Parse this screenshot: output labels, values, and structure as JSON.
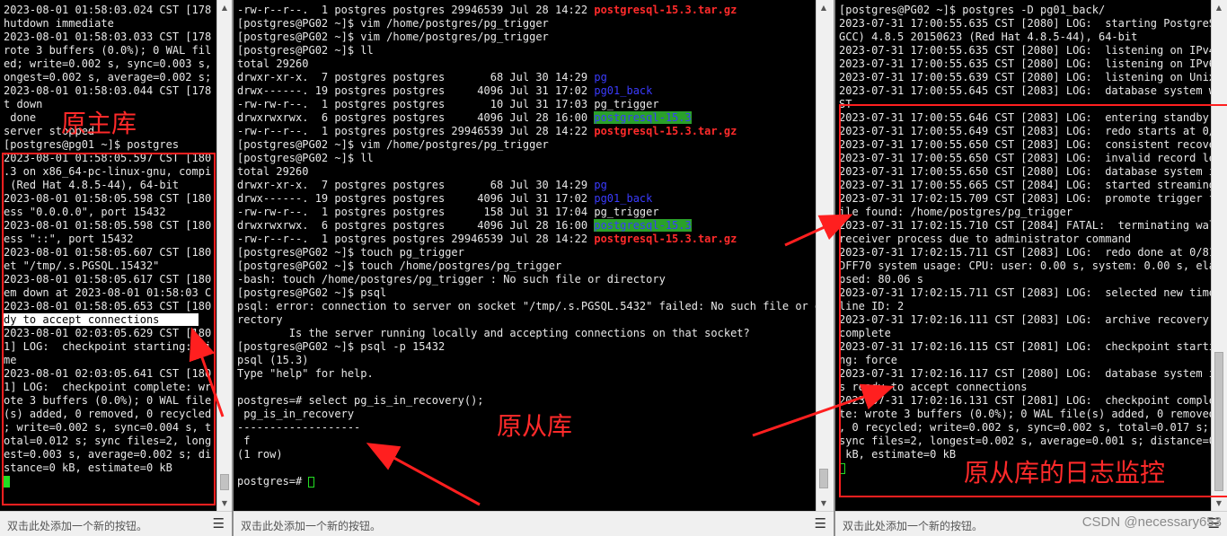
{
  "left": {
    "lines": [
      [
        {
          "t": "2023-08-01 01:58:03.024 CST [178"
        }
      ],
      [
        {
          "t": "hutdown immediate"
        }
      ],
      [
        {
          "t": "2023-08-01 01:58:03.033 CST [178"
        }
      ],
      [
        {
          "t": "rote 3 buffers (0.0%); 0 WAL fil"
        }
      ],
      [
        {
          "t": "ed; write=0.002 s, sync=0.003 s,"
        }
      ],
      [
        {
          "t": "ongest=0.002 s, average=0.002 s;"
        }
      ],
      [
        {
          "t": "2023-08-01 01:58:03.044 CST [178"
        }
      ],
      [
        {
          "t": "t down"
        }
      ],
      [
        {
          "t": " done"
        }
      ],
      [
        {
          "t": "server stopped"
        }
      ],
      [
        {
          "t": "[postgres@pg01 ~]$ postgres"
        }
      ],
      [
        {
          "t": "2023-08-01 01:58:05.597 CST [180"
        }
      ],
      [
        {
          "t": ".3 on x86_64-pc-linux-gnu, compi"
        }
      ],
      [
        {
          "t": " (Red Hat 4.8.5-44), 64-bit"
        }
      ],
      [
        {
          "t": "2023-08-01 01:58:05.598 CST [180"
        }
      ],
      [
        {
          "t": "ess \"0.0.0.0\", port 15432"
        }
      ],
      [
        {
          "t": "2023-08-01 01:58:05.598 CST [180"
        }
      ],
      [
        {
          "t": "ess \"::\", port 15432"
        }
      ],
      [
        {
          "t": "2023-08-01 01:58:05.607 CST [180"
        }
      ],
      [
        {
          "t": "et \"/tmp/.s.PGSQL.15432\""
        }
      ],
      [
        {
          "t": "2023-08-01 01:58:05.617 CST [180"
        }
      ],
      [
        {
          "t": "em down at 2023-08-01 01:58:03 C"
        }
      ],
      [
        {
          "t": "2023-08-01 01:58:05.653 CST [180"
        }
      ],
      [
        {
          "t": "dy to accept connections      ",
          "c": "sel"
        }
      ],
      [
        {
          "t": "2023-08-01 02:03:05.629 CST [180"
        }
      ],
      [
        {
          "t": "1] LOG:  checkpoint starting: ti"
        }
      ],
      [
        {
          "t": "me"
        }
      ],
      [
        {
          "t": "2023-08-01 02:03:05.641 CST [180"
        }
      ],
      [
        {
          "t": "1] LOG:  checkpoint complete: wr"
        }
      ],
      [
        {
          "t": "ote 3 buffers (0.0%); 0 WAL file"
        }
      ],
      [
        {
          "t": "(s) added, 0 removed, 0 recycled"
        }
      ],
      [
        {
          "t": "; write=0.002 s, sync=0.004 s, t"
        }
      ],
      [
        {
          "t": "otal=0.012 s; sync files=2, long"
        }
      ],
      [
        {
          "t": "est=0.003 s, average=0.002 s; di"
        }
      ],
      [
        {
          "t": "stance=0 kB, estimate=0 kB"
        }
      ],
      [
        {
          "t": "",
          "cursor": "solid"
        }
      ]
    ],
    "status_text": "双击此处添加一个新的按钮。",
    "annotation": "原主库"
  },
  "middle": {
    "lines": [
      [
        {
          "t": "-rw-r--r--.  1 postgres postgres 29946539 Jul 28 14:22 "
        },
        {
          "t": "postgresql-15.3.tar.gz",
          "c": "red-b"
        }
      ],
      [
        {
          "t": "[postgres@PG02 ~]$ vim /home/postgres/pg_trigger"
        }
      ],
      [
        {
          "t": "[postgres@PG02 ~]$ vim /home/postgres/pg_trigger"
        }
      ],
      [
        {
          "t": "[postgres@PG02 ~]$ ll"
        }
      ],
      [
        {
          "t": "total 29260"
        }
      ],
      [
        {
          "t": "drwxr-xr-x.  7 postgres postgres       68 Jul 30 14:29 "
        },
        {
          "t": "pg",
          "c": "dir-blue"
        }
      ],
      [
        {
          "t": "drwx------. 19 postgres postgres     4096 Jul 31 17:02 "
        },
        {
          "t": "pg01_back",
          "c": "dir-blue"
        }
      ],
      [
        {
          "t": "-rw-rw-r--.  1 postgres postgres       10 Jul 31 17:03 pg_trigger"
        }
      ],
      [
        {
          "t": "drwxrwxrwx.  6 postgres postgres     4096 Jul 28 16:00 "
        },
        {
          "t": "postgresql-15.3",
          "c": "dir-hl"
        }
      ],
      [
        {
          "t": "-rw-r--r--.  1 postgres postgres 29946539 Jul 28 14:22 "
        },
        {
          "t": "postgresql-15.3.tar.gz",
          "c": "red-b"
        }
      ],
      [
        {
          "t": "[postgres@PG02 ~]$ vim /home/postgres/pg_trigger"
        }
      ],
      [
        {
          "t": "[postgres@PG02 ~]$ ll"
        }
      ],
      [
        {
          "t": "total 29260"
        }
      ],
      [
        {
          "t": "drwxr-xr-x.  7 postgres postgres       68 Jul 30 14:29 "
        },
        {
          "t": "pg",
          "c": "dir-blue"
        }
      ],
      [
        {
          "t": "drwx------. 19 postgres postgres     4096 Jul 31 17:02 "
        },
        {
          "t": "pg01_back",
          "c": "dir-blue"
        }
      ],
      [
        {
          "t": "-rw-rw-r--.  1 postgres postgres      158 Jul 31 17:04 pg_trigger"
        }
      ],
      [
        {
          "t": "drwxrwxrwx.  6 postgres postgres     4096 Jul 28 16:00 "
        },
        {
          "t": "postgresql-15.3",
          "c": "dir-hl"
        }
      ],
      [
        {
          "t": "-rw-r--r--.  1 postgres postgres 29946539 Jul 28 14:22 "
        },
        {
          "t": "postgresql-15.3.tar.gz",
          "c": "red-b"
        }
      ],
      [
        {
          "t": "[postgres@PG02 ~]$ touch pg_trigger"
        }
      ],
      [
        {
          "t": "[postgres@PG02 ~]$ touch /home/postgres/pg_trigger"
        }
      ],
      [
        {
          "t": "-bash: touch /home/postgres/pg_trigger : No such file or directory"
        }
      ],
      [
        {
          "t": "[postgres@PG02 ~]$ psql"
        }
      ],
      [
        {
          "t": "psql: error: connection to server on socket \"/tmp/.s.PGSQL.5432\" failed: No such file or di"
        }
      ],
      [
        {
          "t": "rectory"
        }
      ],
      [
        {
          "t": "        Is the server running locally and accepting connections on that socket?"
        }
      ],
      [
        {
          "t": "[postgres@PG02 ~]$ psql -p 15432"
        }
      ],
      [
        {
          "t": "psql (15.3)"
        }
      ],
      [
        {
          "t": "Type \"help\" for help."
        }
      ],
      [
        {
          "t": ""
        }
      ],
      [
        {
          "t": "postgres=# select pg_is_in_recovery();"
        }
      ],
      [
        {
          "t": " pg_is_in_recovery"
        }
      ],
      [
        {
          "t": "-------------------"
        }
      ],
      [
        {
          "t": " f"
        }
      ],
      [
        {
          "t": "(1 row)"
        }
      ],
      [
        {
          "t": ""
        }
      ],
      [
        {
          "t": "postgres=# "
        },
        {
          "t": "",
          "cursor": "outline"
        }
      ]
    ],
    "status_text": "双击此处添加一个新的按钮。",
    "annotation": "原从库"
  },
  "right": {
    "lines": [
      [
        {
          "t": "[postgres@PG02 ~]$ postgres -D pg01_back/"
        }
      ],
      [
        {
          "t": "2023-07-31 17:00:55.635 CST [2080] LOG:  starting PostgreS"
        }
      ],
      [
        {
          "t": "GCC) 4.8.5 20150623 (Red Hat 4.8.5-44), 64-bit"
        }
      ],
      [
        {
          "t": "2023-07-31 17:00:55.635 CST [2080] LOG:  listening on IPv4"
        }
      ],
      [
        {
          "t": "2023-07-31 17:00:55.635 CST [2080] LOG:  listening on IPv6"
        }
      ],
      [
        {
          "t": "2023-07-31 17:00:55.639 CST [2080] LOG:  listening on Unix"
        }
      ],
      [
        {
          "t": "2023-07-31 17:00:55.645 CST [2083] LOG:  database system w"
        }
      ],
      [
        {
          "t": "ST"
        }
      ],
      [
        {
          "t": "2023-07-31 17:00:55.646 CST [2083] LOG:  entering standby "
        }
      ],
      [
        {
          "t": "2023-07-31 17:00:55.649 CST [2083] LOG:  redo starts at 0/"
        }
      ],
      [
        {
          "t": "2023-07-31 17:00:55.650 CST [2083] LOG:  consistent recove"
        }
      ],
      [
        {
          "t": "2023-07-31 17:00:55.650 CST [2083] LOG:  invalid record le"
        }
      ],
      [
        {
          "t": "2023-07-31 17:00:55.650 CST [2080] LOG:  database system i"
        }
      ],
      [
        {
          "t": "2023-07-31 17:00:55.665 CST [2084] LOG:  started streaming"
        }
      ],
      [
        {
          "t": "2023-07-31 17:02:15.709 CST [2083] LOG:  promote trigger f"
        }
      ],
      [
        {
          "t": "ile found: /home/postgres/pg_trigger"
        }
      ],
      [
        {
          "t": "2023-07-31 17:02:15.710 CST [2084] FATAL:  terminating wal"
        }
      ],
      [
        {
          "t": "receiver process due to administrator command"
        }
      ],
      [
        {
          "t": "2023-07-31 17:02:15.711 CST [2083] LOG:  redo done at 0/81"
        }
      ],
      [
        {
          "t": "DFF70 system usage: CPU: user: 0.00 s, system: 0.00 s, ela"
        }
      ],
      [
        {
          "t": "psed: 80.06 s"
        }
      ],
      [
        {
          "t": "2023-07-31 17:02:15.711 CST [2083] LOG:  selected new time"
        }
      ],
      [
        {
          "t": "line ID: 2"
        }
      ],
      [
        {
          "t": "2023-07-31 17:02:16.111 CST [2083] LOG:  archive recovery "
        }
      ],
      [
        {
          "t": "complete"
        }
      ],
      [
        {
          "t": "2023-07-31 17:02:16.115 CST [2081] LOG:  checkpoint starti"
        }
      ],
      [
        {
          "t": "ng: force"
        }
      ],
      [
        {
          "t": "2023-07-31 17:02:16.117 CST [2080] LOG:  database system i"
        }
      ],
      [
        {
          "t": "s ready to accept connections"
        }
      ],
      [
        {
          "t": "2023-07-31 17:02:16.131 CST [2081] LOG:  checkpoint comple"
        }
      ],
      [
        {
          "t": "te: wrote 3 buffers (0.0%); 0 WAL file(s) added, 0 removed"
        }
      ],
      [
        {
          "t": ", 0 recycled; write=0.002 s, sync=0.002 s, total=0.017 s;"
        }
      ],
      [
        {
          "t": "sync files=2, longest=0.002 s, average=0.001 s; distance=0"
        }
      ],
      [
        {
          "t": " kB, estimate=0 kB"
        }
      ],
      [
        {
          "t": "",
          "cursor": "outline"
        }
      ]
    ],
    "status_text": "双击此处添加一个新的按钮。",
    "annotation": "原从库的日志监控"
  },
  "watermark": "CSDN @necessary653",
  "colors": {
    "annotation": "#ff2a2a",
    "directory": "#3b3bff",
    "archive": "#ff2b2b",
    "dir_highlight_bg": "#2aa12a",
    "cursor": "#22dd22"
  }
}
